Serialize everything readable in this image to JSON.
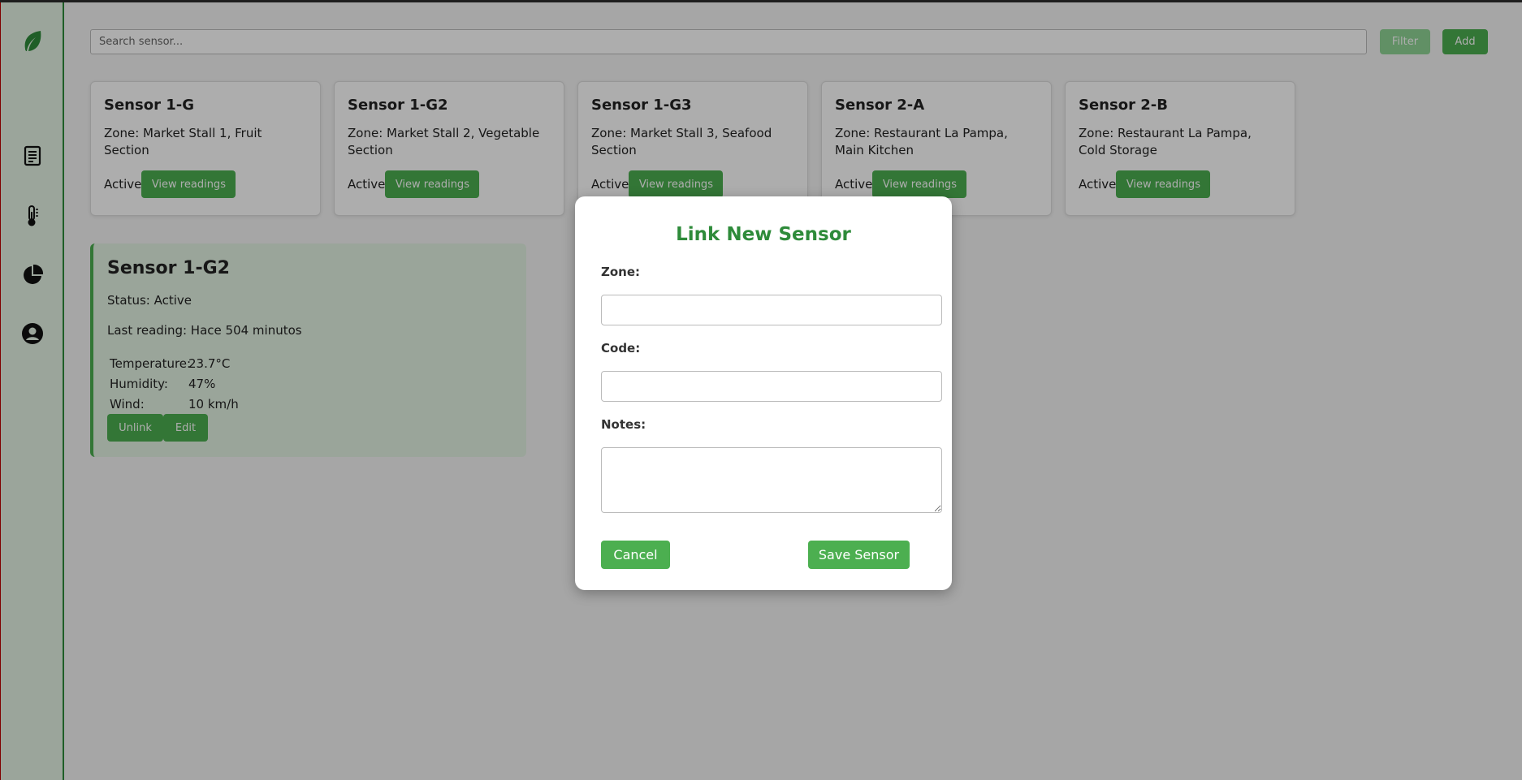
{
  "sidebar": {
    "logo": "leaf-icon",
    "items": [
      {
        "icon": "report-icon"
      },
      {
        "icon": "thermometer-icon"
      },
      {
        "icon": "pie-chart-icon"
      },
      {
        "icon": "user-icon"
      }
    ]
  },
  "toolbar": {
    "search_placeholder": "Search sensor...",
    "filter_label": "Filter",
    "add_label": "Add"
  },
  "sensors": [
    {
      "title": "Sensor 1-G",
      "zone": "Zone: Market Stall 1, Fruit Section",
      "status": "Active",
      "button": "View readings"
    },
    {
      "title": "Sensor 1-G2",
      "zone": "Zone: Market Stall 2, Vegetable Section",
      "status": "Active",
      "button": "View readings"
    },
    {
      "title": "Sensor 1-G3",
      "zone": "Zone: Market Stall 3, Seafood Section",
      "status": "Active",
      "button": "View readings"
    },
    {
      "title": "Sensor 2-A",
      "zone": "Zone: Restaurant La Pampa, Main Kitchen",
      "status": "Active",
      "button": "View readings"
    },
    {
      "title": "Sensor 2-B",
      "zone": "Zone: Restaurant La Pampa, Cold Storage",
      "status": "Active",
      "button": "View readings"
    }
  ],
  "detail": {
    "title": "Sensor 1-G2",
    "status": "Status: Active",
    "last_reading": "Last reading: Hace 504 minutos",
    "readings": [
      {
        "label": "Temperature:",
        "value": "23.7°C"
      },
      {
        "label": "Humidity:",
        "value": "47%"
      },
      {
        "label": "Wind:",
        "value": "10 km/h"
      }
    ],
    "unlink_label": "Unlink",
    "edit_label": "Edit"
  },
  "modal": {
    "title": "Link New Sensor",
    "zone_label": "Zone:",
    "code_label": "Code:",
    "notes_label": "Notes:",
    "zone_value": "",
    "code_value": "",
    "notes_value": "",
    "cancel_label": "Cancel",
    "save_label": "Save Sensor"
  },
  "colors": {
    "accent": "#4caf50",
    "accent_dark": "#2e8b3a",
    "sidebar_bg": "#e5f3e5"
  }
}
